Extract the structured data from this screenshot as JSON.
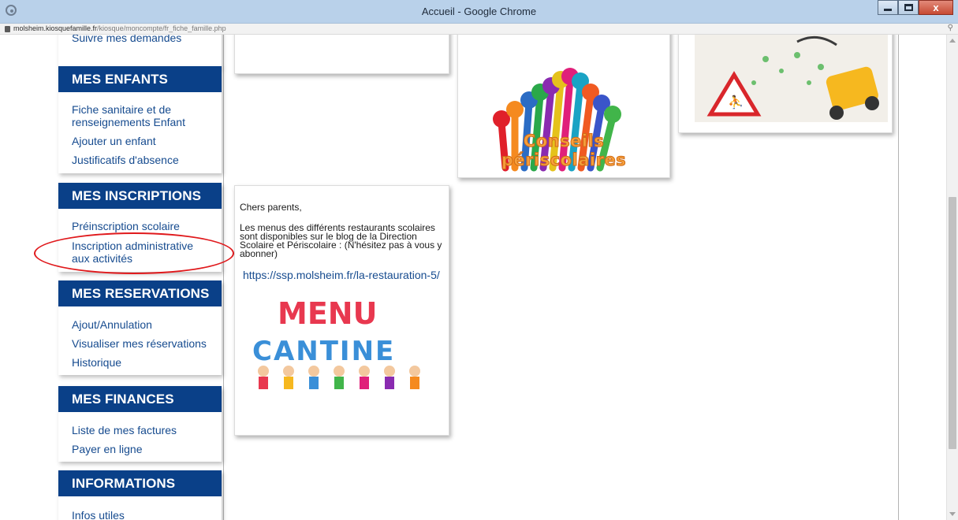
{
  "window": {
    "title": "Accueil - Google Chrome",
    "close_symbol": "x"
  },
  "address": {
    "host": "molsheim.kiosquefamille.fr",
    "path": "/kiosque/moncompte/fr_fiche_famille.php",
    "zoom_icon": "⚲"
  },
  "sidebar": {
    "top_link": "Suivre mes demandes",
    "sections": [
      {
        "title": "MES ENFANTS",
        "links": [
          "Fiche sanitaire et de renseignements Enfant",
          "Ajouter un enfant",
          "Justificatifs d'absence"
        ]
      },
      {
        "title": "MES INSCRIPTIONS",
        "links": [
          "Préinscription scolaire",
          "Inscription administrative aux activités"
        ]
      },
      {
        "title": "MES RESERVATIONS",
        "links": [
          "Ajout/Annulation",
          "Visualiser mes réservations",
          "Historique"
        ]
      },
      {
        "title": "MES FINANCES",
        "links": [
          "Liste de mes factures",
          "Payer en ligne"
        ]
      },
      {
        "title": "INFORMATIONS",
        "links": [
          "Infos utiles"
        ]
      }
    ]
  },
  "cards": {
    "conseils_label": "Conseils périscolaires",
    "menus_greeting": "Chers parents,",
    "menus_text": "Les menus des différents restaurants scolaires sont disponibles sur le blog de la Direction Scolaire et Périscolaire : (N'hésitez pas à vous y abonner)",
    "menus_link": "https://ssp.molsheim.fr/la-restauration-5/",
    "menu_art_word1": "MENU",
    "menu_art_word2": "CANTINE"
  },
  "colors": {
    "header_blue": "#0a4088",
    "link_blue": "#164b8f",
    "highlight_red": "#e0191c"
  }
}
